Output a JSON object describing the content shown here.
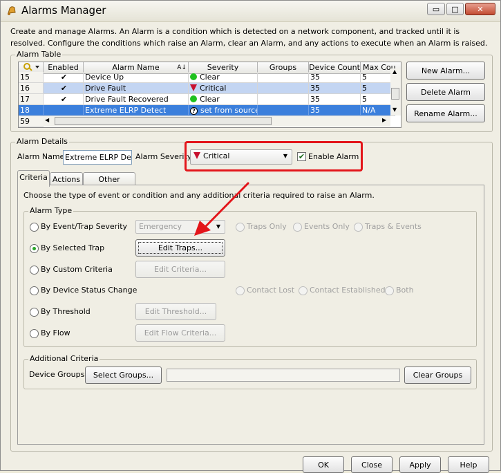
{
  "window": {
    "title": "Alarms Manager",
    "minimize_glyph": "▭",
    "maximize_glyph": "□",
    "close_glyph": "✕"
  },
  "description": "Create and manage Alarms. An Alarm is a condition which is detected on a network component, and tracked until it is resolved. Configure the conditions which raise an Alarm, clear an Alarm, and any actions to execute when an Alarm is raised.",
  "alarm_table": {
    "group_label": "Alarm Table",
    "columns": [
      "Enabled",
      "Alarm Name",
      "Severity",
      "Groups",
      "Device Count",
      "Max Cou"
    ],
    "rows": [
      {
        "num": "15",
        "enabled": "✔",
        "name": "Device Up",
        "severity": "Clear",
        "groups": "",
        "device_count": "35",
        "max_count": "5"
      },
      {
        "num": "16",
        "enabled": "✔",
        "name": "Drive Fault",
        "severity": "Critical",
        "groups": "",
        "device_count": "35",
        "max_count": "5"
      },
      {
        "num": "17",
        "enabled": "✔",
        "name": "Drive Fault Recovered",
        "severity": "Clear",
        "groups": "",
        "device_count": "35",
        "max_count": "5"
      },
      {
        "num": "18",
        "enabled": "",
        "name": "Extreme ELRP Detect",
        "severity": "set from source",
        "groups": "",
        "device_count": "35",
        "max_count": "N/A"
      }
    ],
    "footer_num": "59",
    "buttons": {
      "new": "New Alarm...",
      "delete": "Delete Alarm",
      "rename": "Rename Alarm..."
    }
  },
  "alarm_details": {
    "group_label": "Alarm Details",
    "name_label": "Alarm Name:",
    "name_value": "Extreme ELRP Detec",
    "severity_label": "Alarm Severity:",
    "severity_value": "Critical",
    "enable_label": "Enable Alarm"
  },
  "tabs": [
    "Criteria",
    "Actions",
    "Other Options"
  ],
  "criteria": {
    "instructions": "Choose the type of event or condition and any additional criteria required to raise an Alarm.",
    "alarm_type_label": "Alarm Type",
    "options": {
      "event_trap": "By Event/Trap Severity",
      "selected_trap": "By Selected Trap",
      "custom": "By Custom Criteria",
      "device_status": "By Device Status Change",
      "threshold": "By Threshold",
      "flow": "By Flow"
    },
    "severity_combo": "Emergency",
    "trap_scope": [
      "Traps Only",
      "Events Only",
      "Traps & Events"
    ],
    "status_scope": [
      "Contact Lost",
      "Contact Established",
      "Both"
    ],
    "buttons": {
      "edit_traps": "Edit Traps...",
      "edit_criteria": "Edit Criteria...",
      "edit_threshold": "Edit Threshold...",
      "edit_flow": "Edit Flow Criteria..."
    },
    "additional_label": "Additional Criteria",
    "device_groups_label": "Device Groups:",
    "select_groups": "Select Groups...",
    "clear_groups": "Clear Groups"
  },
  "footer": {
    "ok": "OK",
    "close": "Close",
    "apply": "Apply",
    "help": "Help"
  },
  "colors": {
    "accent_red": "#e3151a",
    "selection_blue": "#3b7fdc",
    "clear_green": "#1ec11e"
  }
}
